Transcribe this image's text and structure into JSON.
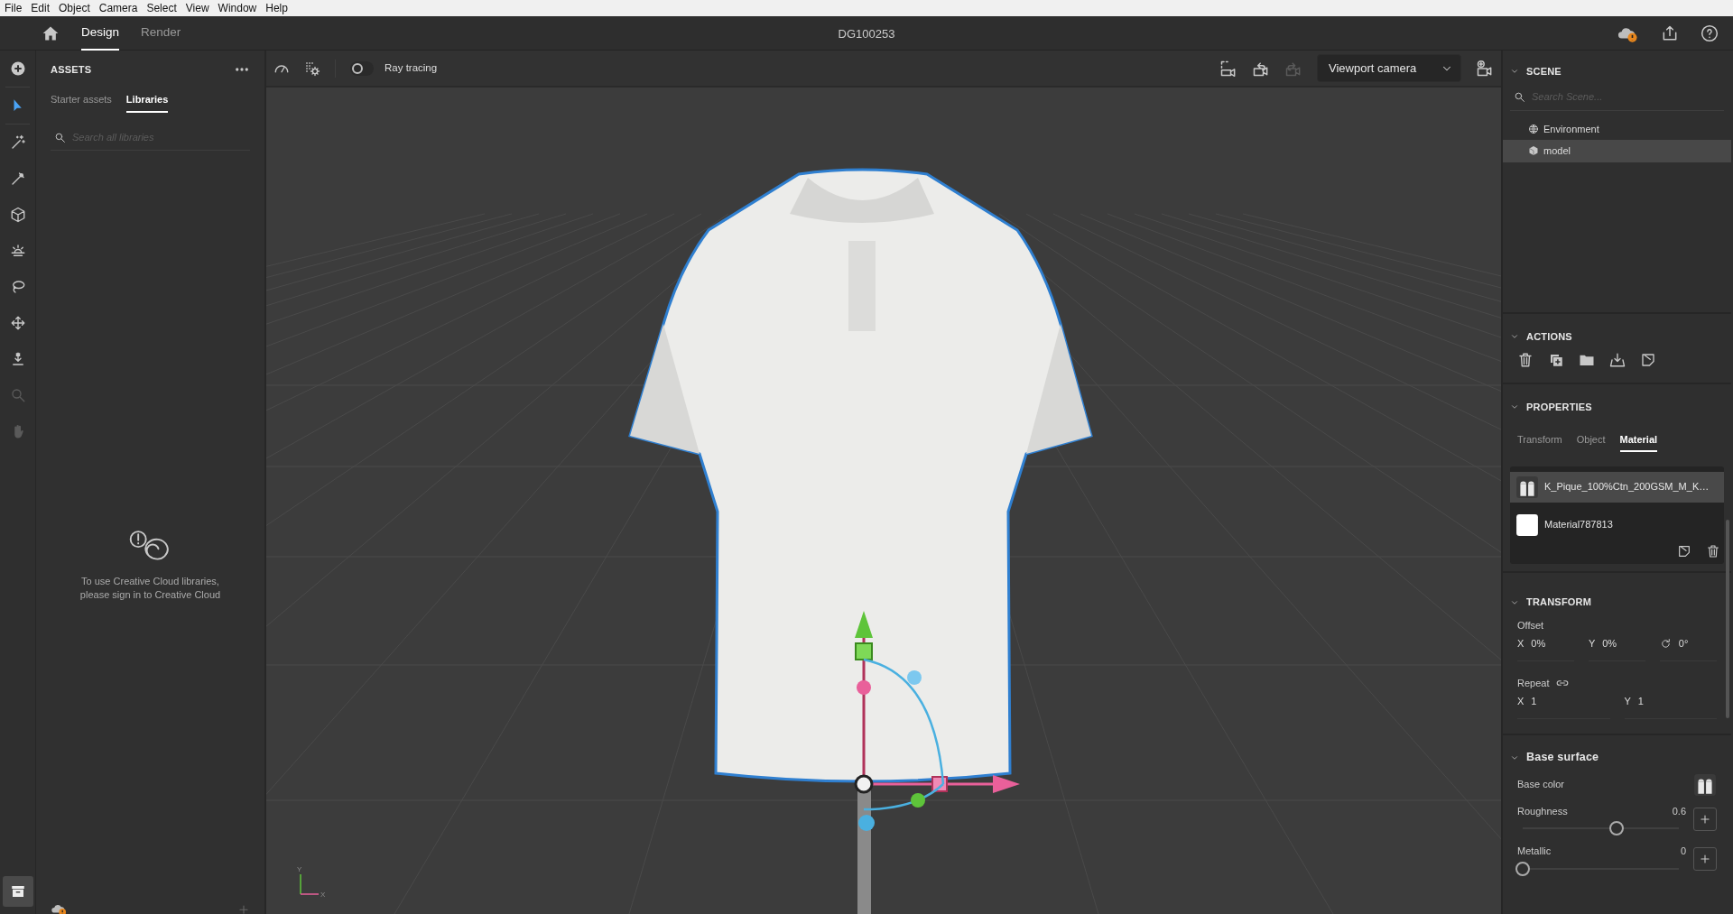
{
  "menu_bar": [
    "File",
    "Edit",
    "Object",
    "Camera",
    "Select",
    "View",
    "Window",
    "Help"
  ],
  "header": {
    "tabs": [
      {
        "label": "Design",
        "selected": true
      },
      {
        "label": "Render",
        "selected": false
      }
    ],
    "title": "DG100253"
  },
  "tools": [
    {
      "selected": false,
      "disabled": false
    },
    {
      "selected": true,
      "disabled": false
    },
    {
      "selected": false,
      "disabled": false
    },
    {
      "selected": false,
      "disabled": false
    },
    {
      "selected": false,
      "disabled": false
    },
    {
      "selected": false,
      "disabled": false
    },
    {
      "selected": false,
      "disabled": false
    },
    {
      "selected": false,
      "disabled": false
    },
    {
      "selected": false,
      "disabled": false
    },
    {
      "selected": false,
      "disabled": true
    },
    {
      "selected": false,
      "disabled": true
    }
  ],
  "panel_toggle": {
    "selected": true
  },
  "assets": {
    "title": "ASSETS",
    "tabs": [
      {
        "label": "Starter assets",
        "selected": false
      },
      {
        "label": "Libraries",
        "selected": true
      }
    ],
    "search": {
      "placeholder": "Search all libraries"
    },
    "message": "To use Creative Cloud libraries, please sign in to Creative Cloud"
  },
  "viewport_toolbar": {
    "ray_tracing": {
      "label": "Ray tracing",
      "on": false
    },
    "camera": "Viewport camera"
  },
  "viewport": {
    "kind": "picture",
    "axis_labels": [
      "Y",
      "X"
    ]
  },
  "scene": {
    "title": "SCENE",
    "search": {
      "placeholder": "Search Scene..."
    },
    "items": [
      {
        "label": "Environment",
        "selected": false
      },
      {
        "label": "model",
        "selected": true
      }
    ]
  },
  "actions": {
    "title": "ACTIONS"
  },
  "properties": {
    "title": "PROPERTIES",
    "tabs": [
      {
        "label": "Transform",
        "selected": false
      },
      {
        "label": "Object",
        "selected": false
      },
      {
        "label": "Material",
        "selected": true
      }
    ],
    "materials": [
      {
        "name": "K_Pique_100%Ctn_200GSM_M_K…",
        "selected": true
      },
      {
        "name": "Material787813",
        "selected": false
      }
    ]
  },
  "transform": {
    "title": "TRANSFORM",
    "offset_label": "Offset",
    "offset": [
      {
        "kind": "axis",
        "label": "X",
        "value": "0%"
      },
      {
        "kind": "axis",
        "label": "Y",
        "value": "0%"
      },
      {
        "kind": "rotation",
        "value": "0°"
      }
    ],
    "repeat_label": "Repeat",
    "repeat": [
      {
        "kind": "axis",
        "label": "X",
        "value": "1"
      },
      {
        "kind": "axis",
        "label": "Y",
        "value": "1"
      }
    ]
  },
  "base_surface": {
    "title": "Base surface",
    "base_color_label": "Base color",
    "sliders": [
      {
        "label": "Roughness",
        "reading": "0.6",
        "level": 0.6
      },
      {
        "label": "Metallic",
        "reading": "0",
        "level": 0
      }
    ]
  }
}
